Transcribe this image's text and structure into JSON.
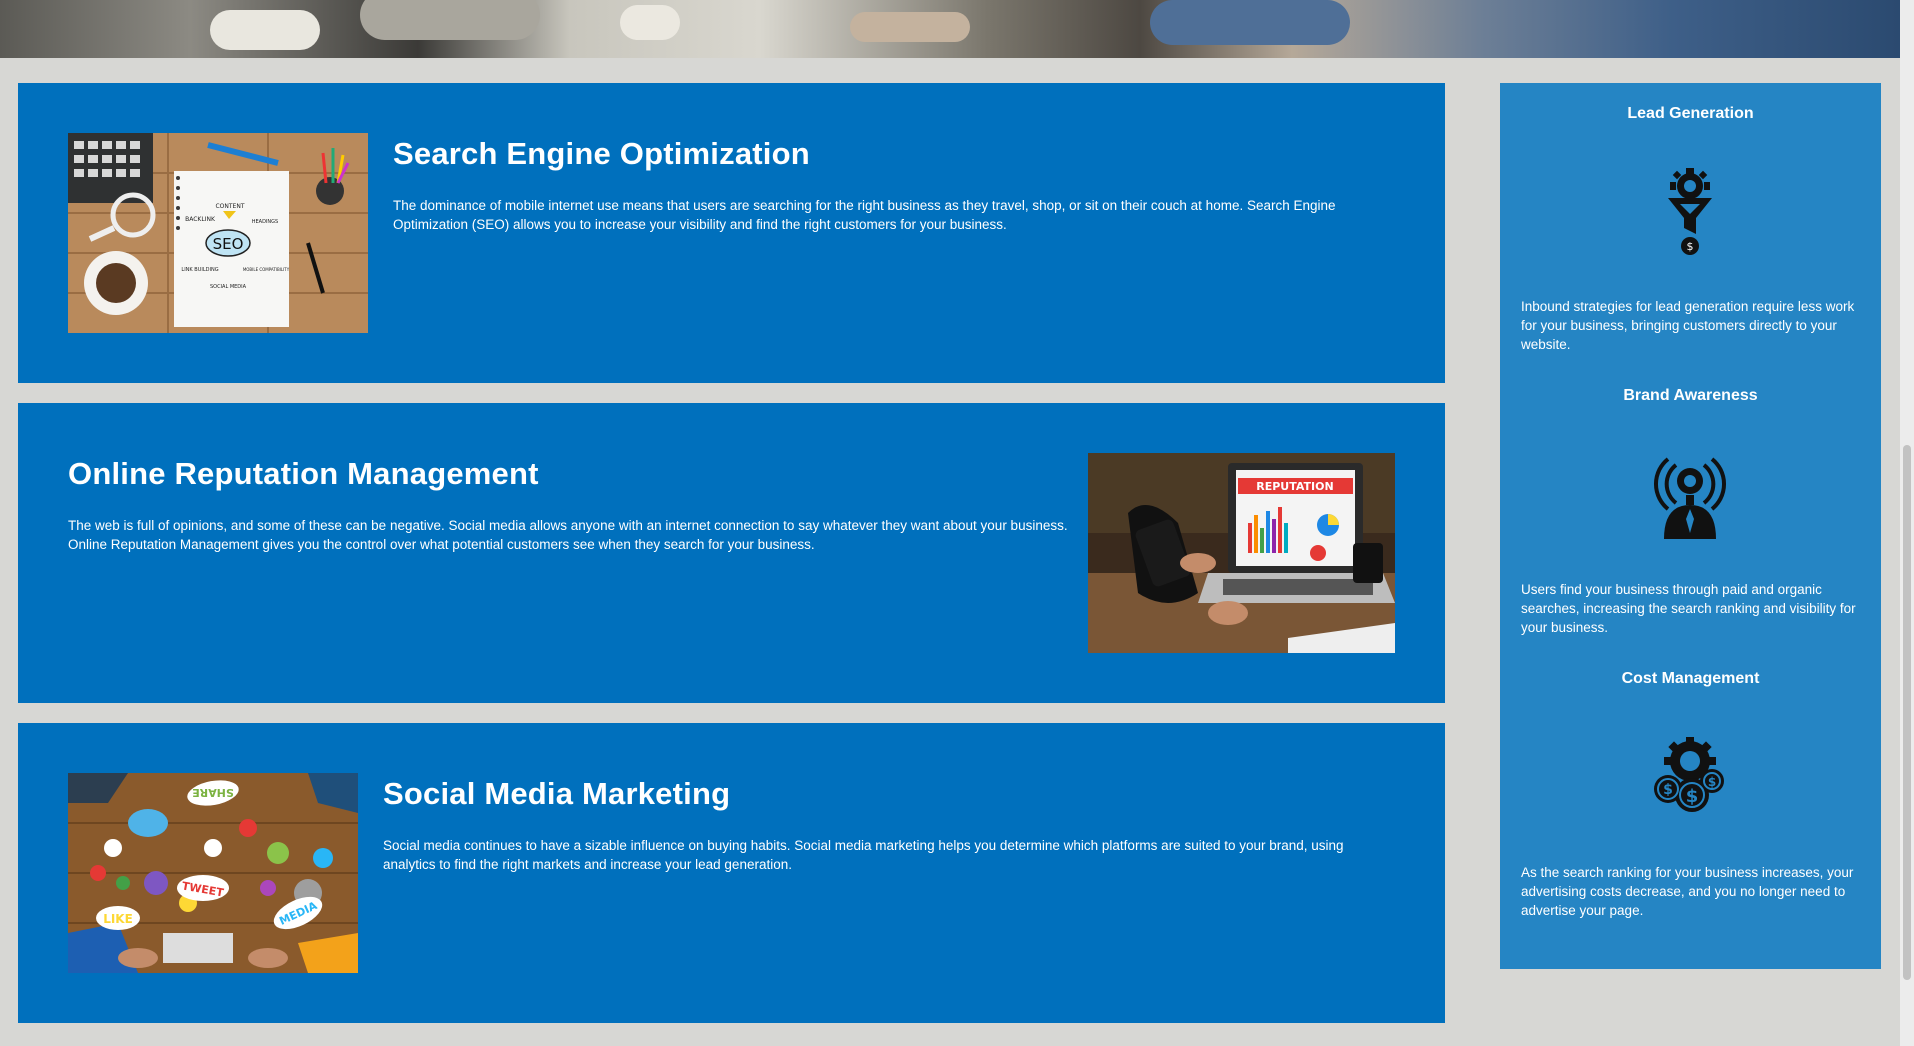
{
  "services": [
    {
      "title": "Search Engine Optimization",
      "body": "The dominance of mobile internet use means that users are searching for the right business as they travel, shop, or sit on their couch at home. Search Engine Optimization (SEO) allows you to increase your visibility and find the right customers for your business.",
      "image_words": [
        "CONTENT",
        "BACKLINK",
        "HEADINGS",
        "SEO",
        "LINK BUILDING",
        "MOBILE COMPATIBILITY",
        "SOCIAL MEDIA"
      ]
    },
    {
      "title": "Online Reputation Management",
      "body": "The web is full of opinions, and some of these can be negative. Social media allows anyone with an internet connection to say whatever they want about your business. Online Reputation Management gives you the control over what potential customers see when they search for your business.",
      "image_words": [
        "REPUTATION"
      ]
    },
    {
      "title": "Social Media Marketing",
      "body": "Social media continues to have a sizable influence on buying habits. Social media marketing helps you determine which platforms are suited to your brand, using analytics to find the right markets and increase your lead generation.",
      "image_words": [
        "SHARE",
        "TWEET",
        "LIKE",
        "MEDIA"
      ]
    }
  ],
  "sidebar": {
    "items": [
      {
        "title": "Lead Generation",
        "icon": "funnel-dollar-icon",
        "body": "Inbound strategies for lead generation require less work for your business, bringing customers directly to your website."
      },
      {
        "title": "Brand Awareness",
        "icon": "lightbulb-person-icon",
        "body": "Users find your business through paid and organic searches, increasing the search ranking and visibility for your business."
      },
      {
        "title": "Cost Management",
        "icon": "gear-coins-icon",
        "body": "As the search ranking for your business increases, your advertising costs decrease, and you no longer need to advertise your page."
      }
    ]
  },
  "colors": {
    "page_bg": "#d7d7d4",
    "card_bg": "#0070bd",
    "sidebar_bg": "#2585c4",
    "text": "#ffffff"
  }
}
